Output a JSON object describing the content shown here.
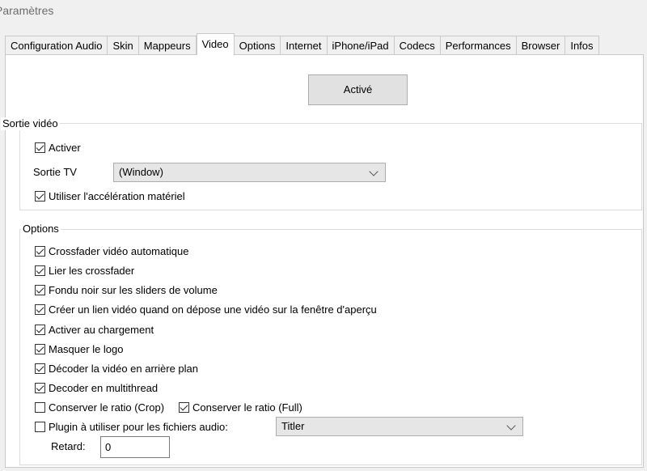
{
  "window": {
    "title": "Paramètres"
  },
  "tabs": [
    {
      "label": "Configuration Audio"
    },
    {
      "label": "Skin"
    },
    {
      "label": "Mappeurs"
    },
    {
      "label": "Video"
    },
    {
      "label": "Options"
    },
    {
      "label": "Internet"
    },
    {
      "label": "iPhone/iPad"
    },
    {
      "label": "Codecs"
    },
    {
      "label": "Performances"
    },
    {
      "label": "Browser"
    },
    {
      "label": "Infos"
    }
  ],
  "active_tab": "Video",
  "activate_button": {
    "label": "Activé"
  },
  "video_output": {
    "legend": "Sortie vidéo",
    "enable": {
      "label": "Activer",
      "checked": true
    },
    "tv_output": {
      "label": "Sortie TV",
      "value": "(Window)"
    },
    "hw_accel": {
      "label": "Utiliser l'accélération matériel",
      "checked": true
    }
  },
  "options": {
    "legend": "Options",
    "items": [
      {
        "label": "Crossfader vidéo automatique",
        "checked": true
      },
      {
        "label": "Lier les crossfader",
        "checked": true
      },
      {
        "label": "Fondu noir sur les sliders de volume",
        "checked": true
      },
      {
        "label": "Créer un lien vidéo quand on dépose une vidéo sur la fenêtre d'aperçu",
        "checked": true
      },
      {
        "label": "Activer au chargement",
        "checked": true
      },
      {
        "label": "Masquer le logo",
        "checked": true
      },
      {
        "label": "Décoder la vidéo en arrière plan",
        "checked": true
      },
      {
        "label": "Decoder en multithread",
        "checked": true
      }
    ],
    "ratio_crop": {
      "label": "Conserver le ratio (Crop)",
      "checked": false
    },
    "ratio_full": {
      "label": "Conserver le ratio (Full)",
      "checked": true
    },
    "audio_plugin": {
      "label": "Plugin à utiliser pour les fichiers audio:",
      "checked": false,
      "value": "Titler"
    },
    "delay": {
      "label": "Retard:",
      "value": "0"
    }
  }
}
